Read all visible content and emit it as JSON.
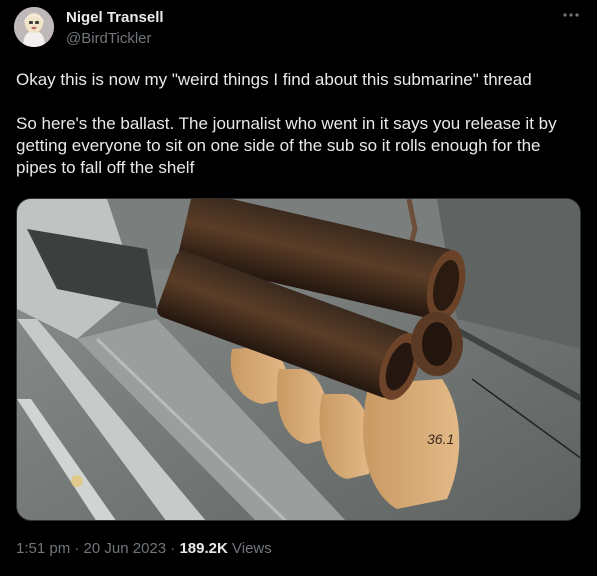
{
  "author": {
    "display_name": "Nigel Transell",
    "handle": "@BirdTickler",
    "avatar_icon": "profile-photo"
  },
  "more_icon": "more-options-icon",
  "tweet": {
    "paragraphs": [
      "Okay this is now my \"weird things I find about this submarine\" thread",
      "So here's the ballast. The journalist who went in it says you release it by getting everyone to sit on one side of the sub so it rolls enough for the pipes to fall off the shelf"
    ]
  },
  "media": {
    "sandbag_marking": "36.1"
  },
  "meta": {
    "time": "1:51 pm",
    "separator": "·",
    "date": "20 Jun 2023",
    "views_count": "189.2K",
    "views_label": "Views"
  },
  "colors": {
    "background": "#000000",
    "text_primary": "#e7e9ea",
    "text_secondary": "#71767b",
    "border": "#2f3336"
  }
}
